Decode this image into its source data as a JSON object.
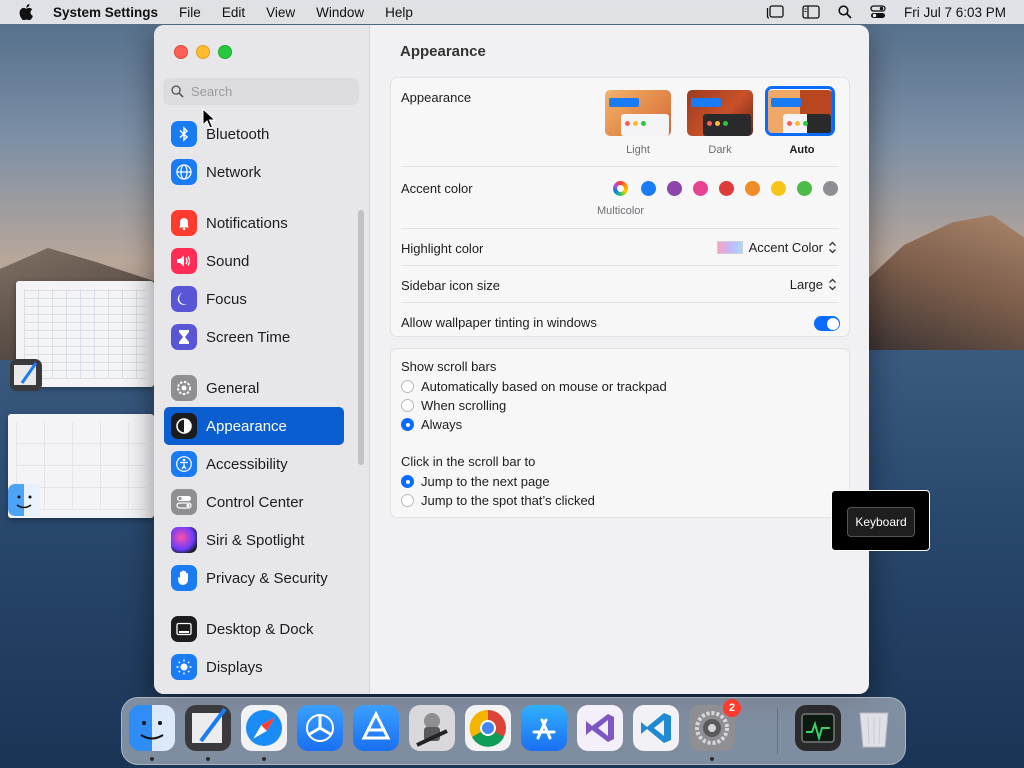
{
  "menubar": {
    "app_name": "System Settings",
    "menus": [
      "File",
      "Edit",
      "View",
      "Window",
      "Help"
    ],
    "clock": "Fri Jul 7  6:03 PM",
    "status_icons": [
      "stage-manager-icon",
      "sidebar-icon",
      "search-icon",
      "control-center-icon"
    ]
  },
  "search": {
    "placeholder": "Search"
  },
  "sidebar": {
    "items": [
      {
        "label": "Bluetooth",
        "icon": "bluetooth-icon",
        "color": "#1a7cf5"
      },
      {
        "label": "Network",
        "icon": "globe-icon",
        "color": "#1a7cf5"
      },
      {
        "label": "Notifications",
        "icon": "bell-icon",
        "color": "#ff3b30"
      },
      {
        "label": "Sound",
        "icon": "speaker-icon",
        "color": "#ff2d55"
      },
      {
        "label": "Focus",
        "icon": "moon-icon",
        "color": "#5856d6"
      },
      {
        "label": "Screen Time",
        "icon": "hourglass-icon",
        "color": "#5856d6"
      },
      {
        "label": "General",
        "icon": "gear-icon",
        "color": "#8e8e93"
      },
      {
        "label": "Appearance",
        "icon": "appearance-icon",
        "color": "#1c1c1e"
      },
      {
        "label": "Accessibility",
        "icon": "accessibility-icon",
        "color": "#1a7cf5"
      },
      {
        "label": "Control Center",
        "icon": "toggles-icon",
        "color": "#8e8e93"
      },
      {
        "label": "Siri & Spotlight",
        "icon": "siri-icon",
        "color": "#2a2a2e"
      },
      {
        "label": "Privacy & Security",
        "icon": "hand-icon",
        "color": "#1a7cf5"
      },
      {
        "label": "Desktop & Dock",
        "icon": "dock-icon",
        "color": "#1c1c1e"
      },
      {
        "label": "Displays",
        "icon": "sun-icon",
        "color": "#1a7cf5"
      }
    ],
    "selected": "Appearance"
  },
  "content": {
    "title": "Appearance",
    "appearance": {
      "label": "Appearance",
      "options": [
        "Light",
        "Dark",
        "Auto"
      ],
      "selected": "Auto"
    },
    "accent": {
      "label": "Accent color",
      "selected_label": "Multicolor",
      "colors": [
        "#9b59b6",
        "#1a7cf5",
        "#8e44ad",
        "#e84393",
        "#e03b3b",
        "#f28c28",
        "#f5c518",
        "#4cbb47",
        "#8e8e93"
      ]
    },
    "highlight": {
      "label": "Highlight color",
      "value": "Accent Color"
    },
    "sidebar_icon_size": {
      "label": "Sidebar icon size",
      "value": "Large"
    },
    "wallpaper_tint": {
      "label": "Allow wallpaper tinting in windows",
      "on": true
    },
    "scroll_bars": {
      "label": "Show scroll bars",
      "options": [
        "Automatically based on mouse or trackpad",
        "When scrolling",
        "Always"
      ],
      "selected": "Always"
    },
    "click_scroll": {
      "label": "Click in the scroll bar to",
      "options": [
        "Jump to the next page",
        "Jump to the spot that’s clicked"
      ],
      "selected": "Jump to the next page"
    }
  },
  "keyboard_popup": {
    "label": "Keyboard"
  },
  "dock": {
    "apps": [
      "Finder",
      "Script Editor",
      "Safari",
      "TestFlight",
      "Instruments",
      "Automator",
      "Google Chrome",
      "App Store",
      "Visual Studio",
      "Visual Studio Code",
      "System Settings",
      "Activity Monitor",
      "Trash"
    ],
    "badge_count": "2"
  }
}
